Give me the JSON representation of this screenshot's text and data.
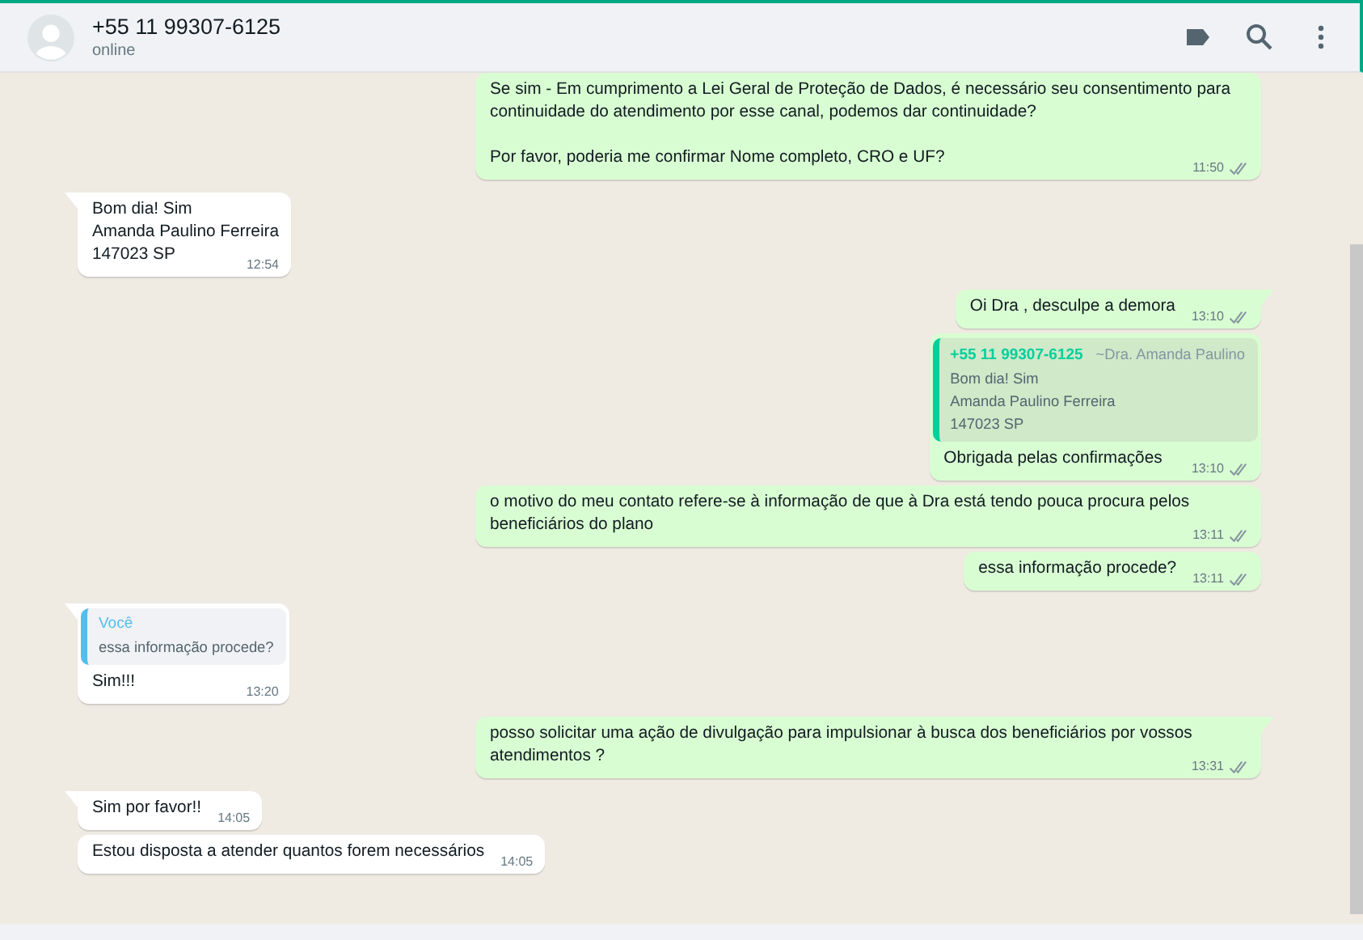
{
  "header": {
    "name": "+55 11 99307-6125",
    "status": "online"
  },
  "messages": [
    {
      "kind": "out",
      "tail": false,
      "text": "Se sim - Em cumprimento a Lei Geral de Proteção de Dados, é necessário seu consentimento para continuidade do atendimento por esse canal, podemos dar continuidade?\n\nPor favor, poderia me confirmar Nome completo, CRO e UF?",
      "time": "11:50"
    },
    {
      "kind": "in",
      "tail": true,
      "text": "Bom dia! Sim\nAmanda Paulino Ferreira\n147023 SP",
      "time": "12:54"
    },
    {
      "kind": "out",
      "tail": true,
      "text": "Oi Dra , desculpe a demora",
      "time": "13:10"
    },
    {
      "kind": "out",
      "tail": false,
      "quote": {
        "author": "+55 11 99307-6125",
        "push_name": "~Dra. Amanda Paulino",
        "text": "Bom dia! Sim\nAmanda Paulino Ferreira\n147023 SP",
        "color": "#06cf9c"
      },
      "text": "Obrigada pelas confirmações",
      "time": "13:10"
    },
    {
      "kind": "out",
      "tail": false,
      "text": "o motivo do meu contato refere-se à informação de que à Dra está tendo pouca procura pelos beneficiários do plano",
      "time": "13:11"
    },
    {
      "kind": "out",
      "tail": false,
      "text": "essa informação procede?",
      "time": "13:11"
    },
    {
      "kind": "in",
      "tail": true,
      "quote": {
        "author": "Você",
        "text": "essa informação procede?",
        "color": "#53bdeb"
      },
      "text": "Sim!!!",
      "time": "13:20"
    },
    {
      "kind": "out",
      "tail": true,
      "text": "posso solicitar uma ação de divulgação para impulsionar à busca dos beneficiários por vossos atendimentos ?",
      "time": "13:31"
    },
    {
      "kind": "in",
      "tail": true,
      "text": "Sim por favor!!",
      "time": "14:05"
    },
    {
      "kind": "in",
      "tail": false,
      "text": "Estou disposta a atender quantos forem necessários",
      "time": "14:05"
    }
  ]
}
